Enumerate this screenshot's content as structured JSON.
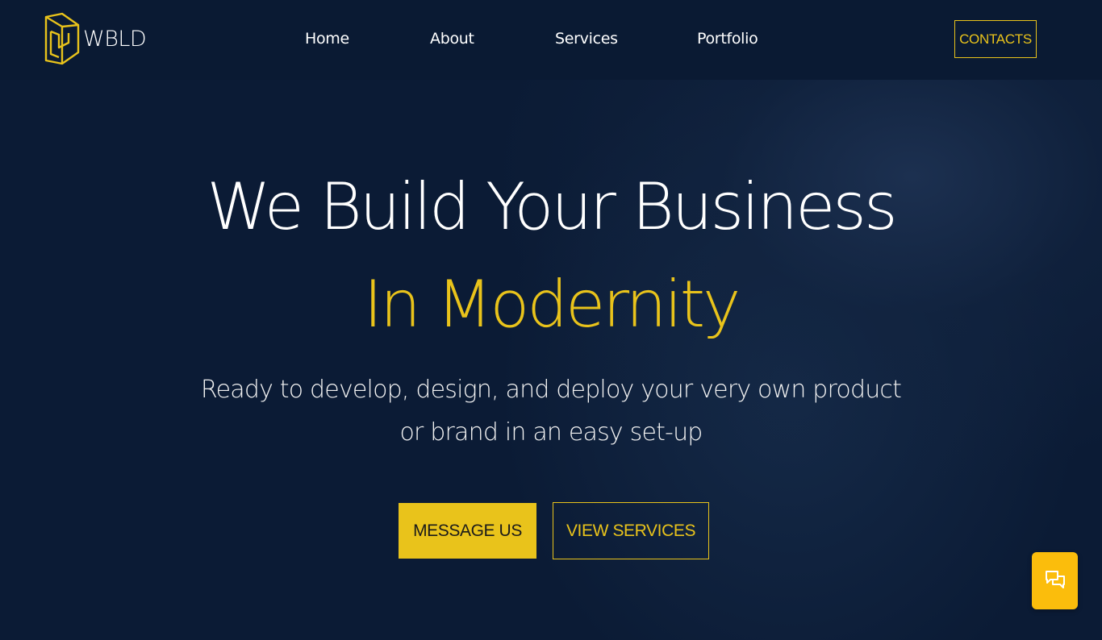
{
  "brand": {
    "name": "WBLD"
  },
  "nav": {
    "items": [
      {
        "label": "Home"
      },
      {
        "label": "About"
      },
      {
        "label": "Services"
      },
      {
        "label": "Portfolio"
      }
    ],
    "contacts_label": "CONTACTS"
  },
  "hero": {
    "title": "We Build Your Business",
    "subtitle": "In Modernity",
    "description": "Ready to develop, design, and deploy your very own product or brand in an easy set-up",
    "primary_button": "MESSAGE US",
    "secondary_button": "VIEW SERVICES"
  },
  "icons": {
    "logo": "wbld-logo-icon",
    "chat": "chat-bubbles-icon"
  },
  "colors": {
    "background": "#0a1a33",
    "accent": "#e9c31b",
    "chat_button": "#fbbd0c",
    "text": "#ffffff"
  }
}
